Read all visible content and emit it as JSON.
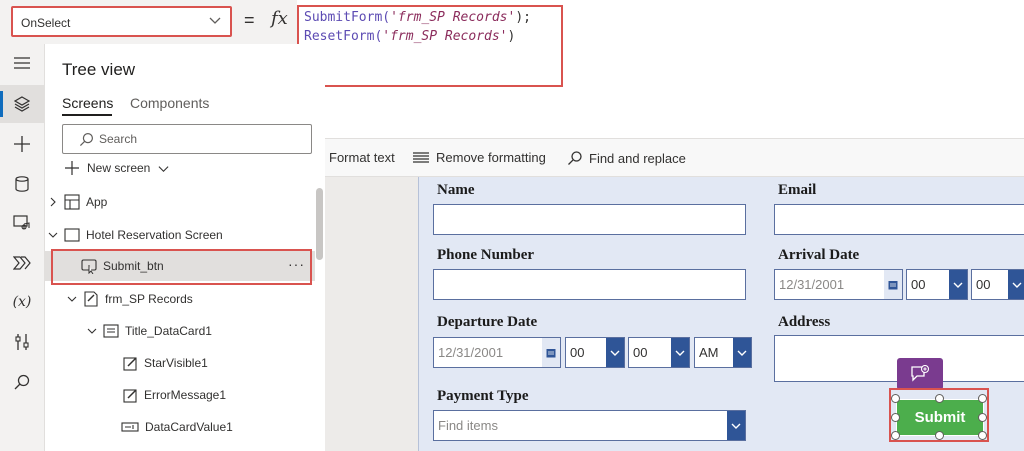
{
  "top_bar": {
    "property_value": "OnSelect",
    "equals": "=",
    "fx": "fx"
  },
  "formula": {
    "line1": {
      "fn": "SubmitForm(",
      "arg": "'frm_SP Records'",
      "end": ");"
    },
    "line2": {
      "fn": "ResetForm(",
      "arg": "'frm_SP Records'",
      "end": ")"
    }
  },
  "format_bar": {
    "format_text": "Format text",
    "remove_formatting": "Remove formatting",
    "find_replace": "Find and replace"
  },
  "tree_view": {
    "title": "Tree view",
    "tabs": [
      "Screens",
      "Components"
    ],
    "search_placeholder": "Search",
    "new_screen": "New screen",
    "items": [
      {
        "label": "App"
      },
      {
        "label": "Hotel Reservation Screen"
      },
      {
        "label": "Submit_btn",
        "more": "···"
      },
      {
        "label": "frm_SP Records"
      },
      {
        "label": "Title_DataCard1"
      },
      {
        "label": "StarVisible1"
      },
      {
        "label": "ErrorMessage1"
      },
      {
        "label": "DataCardValue1"
      }
    ]
  },
  "form": {
    "labels": {
      "name": "Name",
      "email": "Email",
      "phone": "Phone Number",
      "arrival": "Arrival Date",
      "departure": "Departure Date",
      "address": "Address",
      "payment": "Payment Type"
    },
    "arrival_date": "12/31/2001",
    "arrival_hour": "00",
    "arrival_min": "00",
    "departure_date": "12/31/2001",
    "departure_hour": "00",
    "departure_min": "00",
    "departure_ampm": "AM",
    "payment_placeholder": "Find items",
    "submit_label": "Submit"
  },
  "colors": {
    "highlight_red": "#d9534f",
    "submit_green": "#4cae4c",
    "dropdown_blue": "#2f5597",
    "comment_purple": "#7a3b8f"
  }
}
